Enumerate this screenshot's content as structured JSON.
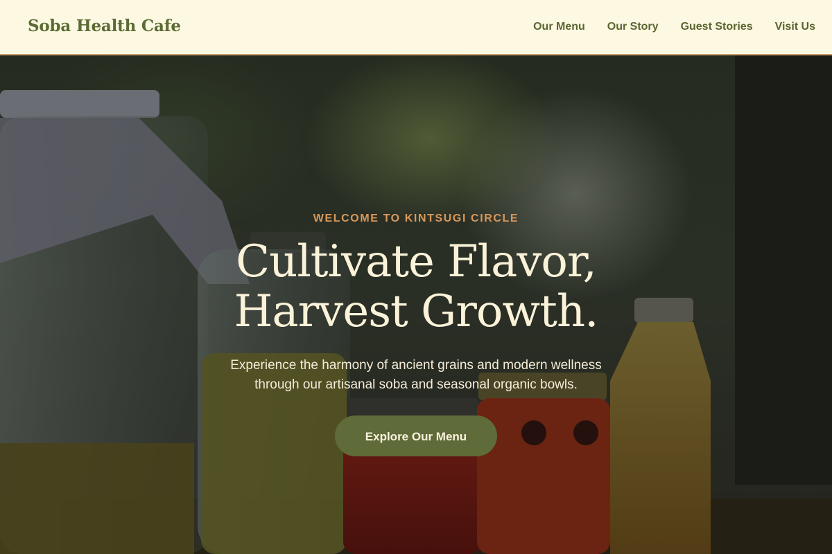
{
  "brand": {
    "name": "Soba Health Cafe"
  },
  "nav": {
    "items": [
      {
        "label": "Our Menu"
      },
      {
        "label": "Our Story"
      },
      {
        "label": "Guest Stories"
      },
      {
        "label": "Visit Us"
      }
    ]
  },
  "hero": {
    "eyebrow": "WELCOME TO KINTSUGI CIRCLE",
    "headline_line1": "Cultivate Flavor,",
    "headline_line2": "Harvest Growth.",
    "subtitle_line1": "Experience the harmony of ancient grains and modern wellness",
    "subtitle_line2": "through our artisanal soba and seasonal organic bowls.",
    "cta_label": "Explore Our Menu"
  },
  "colors": {
    "nav_background": "#fdf8e2",
    "brand_green": "#5b6b34",
    "accent_orange": "#d9985a",
    "cta_green": "#5f6b38",
    "headline_cream": "#fbf3d9"
  }
}
